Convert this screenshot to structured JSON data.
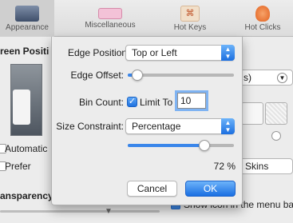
{
  "toolbar": {
    "tabs": [
      {
        "label": "Appearance",
        "icon": "appearance-icon",
        "active": true
      },
      {
        "label": "Miscellaneous",
        "icon": "keyboard-icon",
        "active": false
      },
      {
        "label": "Hot Keys",
        "icon": "hot-keys-icon",
        "active": false
      },
      {
        "label": "Hot Clicks",
        "icon": "hot-clicks-icon",
        "active": false
      }
    ]
  },
  "background": {
    "screen_position_label": "reen Positi",
    "automatic_label": "Automatic",
    "prefer_label": "Prefer",
    "transparency_label": "ansparency",
    "popup_value": "s)",
    "skins_label": "Skins",
    "menubar_label": "Show icon in the menu bar"
  },
  "sheet": {
    "edge_position": {
      "label": "Edge Position:",
      "value": "Top or Left"
    },
    "edge_offset": {
      "label": "Edge Offset:",
      "value": 0.09
    },
    "bin_count": {
      "label": "Bin Count:",
      "checkbox_label": "Limit To",
      "checked": true,
      "value": "10"
    },
    "size_constraint": {
      "label": "Size Constraint:",
      "value": "Percentage",
      "slider_value": 0.72,
      "percent_text": "72 %"
    },
    "cancel_label": "Cancel",
    "ok_label": "OK"
  },
  "colors": {
    "accent": "#2f7fe8",
    "window_bg": "#ececec"
  }
}
